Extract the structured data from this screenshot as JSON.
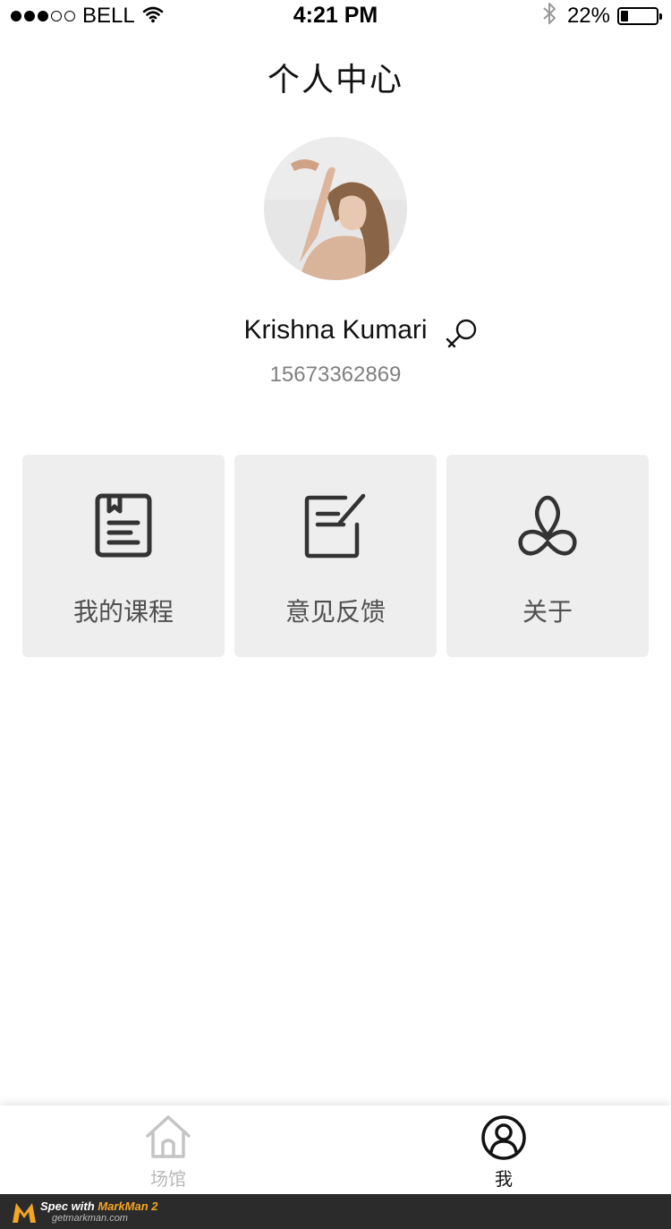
{
  "status_bar": {
    "carrier": "BELL",
    "time": "4:21 PM",
    "battery_percent": "22%",
    "battery_level": 0.22,
    "signal_dots_filled": 3,
    "signal_dots_total": 5,
    "icons": [
      "wifi-icon",
      "bluetooth-icon",
      "battery-icon"
    ]
  },
  "header": {
    "title": "个人中心"
  },
  "profile": {
    "avatar_icon": "avatar-photo",
    "name": "Krishna Kumari",
    "gender_icon": "female-icon",
    "phone": "15673362869"
  },
  "menu": {
    "items": [
      {
        "label": "我的课程",
        "icon": "book-icon"
      },
      {
        "label": "意见反馈",
        "icon": "feedback-edit-icon"
      },
      {
        "label": "关于",
        "icon": "yoga-pose-icon"
      }
    ]
  },
  "tabbar": {
    "tabs": [
      {
        "label": "场馆",
        "icon": "home-icon",
        "active": false
      },
      {
        "label": "我",
        "icon": "user-circle-icon",
        "active": true
      }
    ]
  },
  "footer": {
    "line1_prefix": "Spec with",
    "line1_brand": "MarkMan 2",
    "line2": "getmarkman.com"
  },
  "colors": {
    "title_text": "#121212",
    "phone_text": "#808080",
    "card_label": "#505050",
    "card_bg": "#eeeeee",
    "tab_inactive": "#b8b8b8",
    "tab_active": "#121212",
    "footer_bg": "#2b2b2b"
  }
}
